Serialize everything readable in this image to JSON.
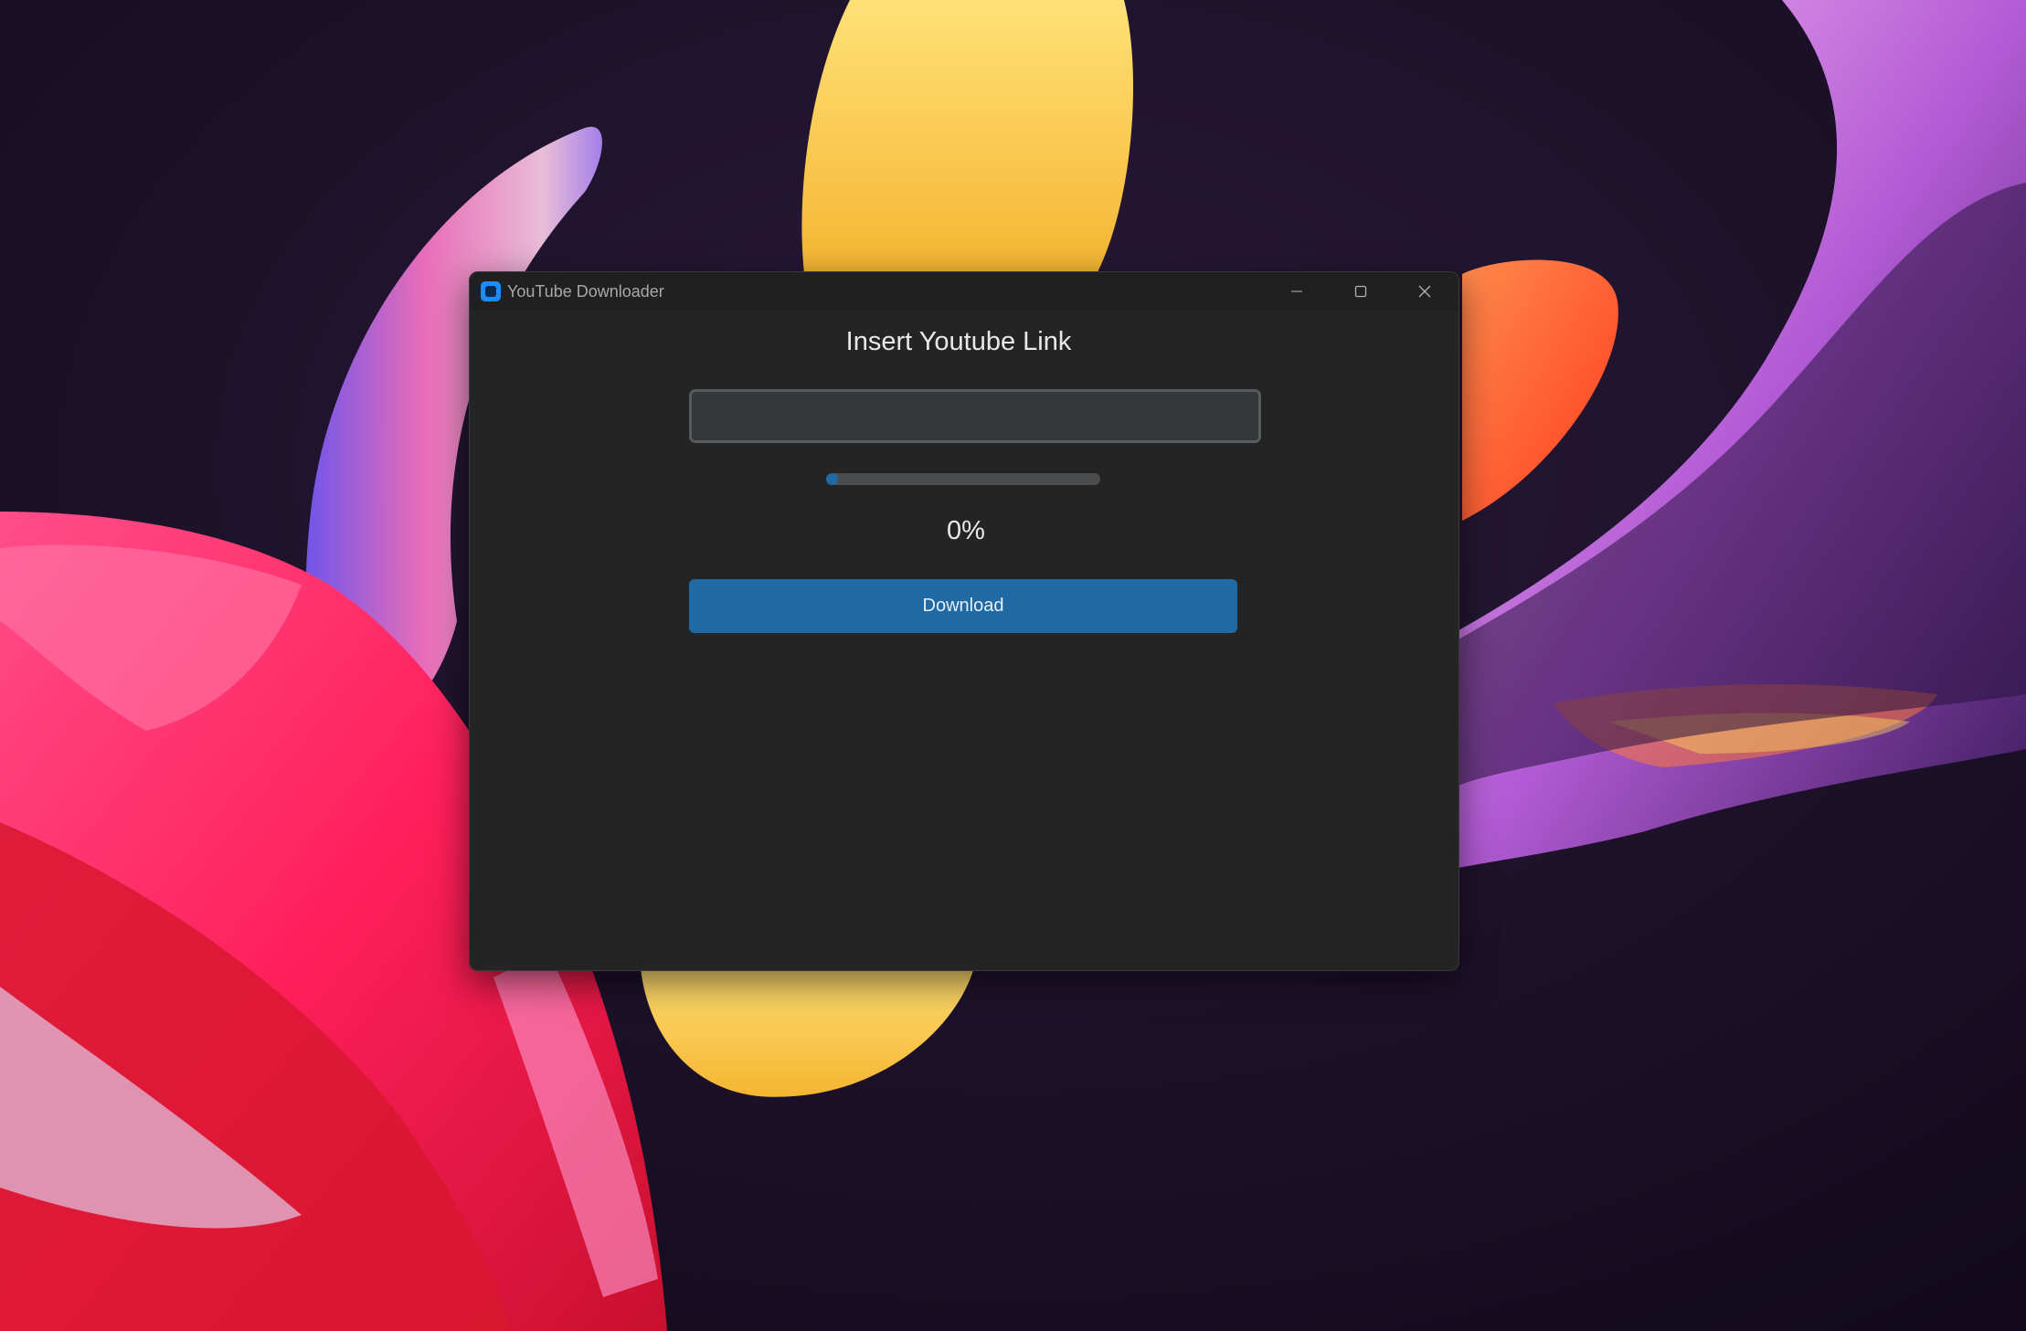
{
  "window": {
    "title": "YouTube Downloader",
    "icon": "app-icon",
    "controls": {
      "minimize_icon": "minimize-icon",
      "maximize_icon": "maximize-icon",
      "close_icon": "close-icon"
    }
  },
  "main": {
    "heading": "Insert Youtube Link",
    "link_input": {
      "value": "",
      "placeholder": ""
    },
    "progress": {
      "fraction": 0.0
    },
    "percent_label": "0%",
    "download_label": "Download"
  },
  "colors": {
    "accent": "#1f6aa5",
    "window_bg": "#242424",
    "titlebar_bg": "#202020",
    "input_bg": "#343638",
    "input_border": "#565b5e",
    "progress_track": "#4a4d50",
    "text": "#e8e8e8"
  }
}
